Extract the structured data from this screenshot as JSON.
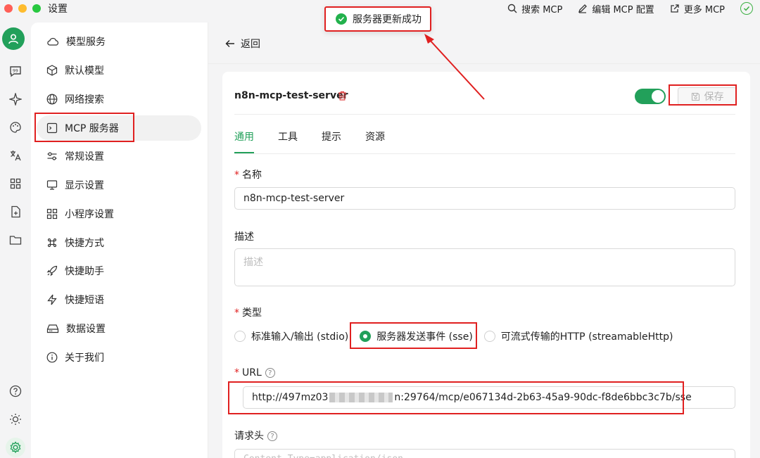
{
  "window": {
    "title": "设置"
  },
  "title_actions": [
    {
      "label": "搜索 MCP",
      "icon": "search-icon"
    },
    {
      "label": "编辑 MCP 配置",
      "icon": "edit-icon"
    },
    {
      "label": "更多 MCP",
      "icon": "external-link-icon"
    }
  ],
  "toast": {
    "text": "服务器更新成功"
  },
  "nav": {
    "items": [
      {
        "label": "模型服务",
        "icon": "cloud-icon"
      },
      {
        "label": "默认模型",
        "icon": "cube-icon"
      },
      {
        "label": "网络搜索",
        "icon": "globe-icon"
      },
      {
        "label": "MCP 服务器",
        "icon": "terminal-icon"
      },
      {
        "label": "常规设置",
        "icon": "sliders-icon"
      },
      {
        "label": "显示设置",
        "icon": "monitor-icon"
      },
      {
        "label": "小程序设置",
        "icon": "grid-icon"
      },
      {
        "label": "快捷方式",
        "icon": "command-icon"
      },
      {
        "label": "快捷助手",
        "icon": "rocket-icon"
      },
      {
        "label": "快捷短语",
        "icon": "zap-icon"
      },
      {
        "label": "数据设置",
        "icon": "hard-drive-icon"
      },
      {
        "label": "关于我们",
        "icon": "info-icon"
      }
    ],
    "active_index": 3
  },
  "main": {
    "back_label": "返回",
    "server_name": "n8n-mcp-test-server",
    "enabled": true,
    "save_label": "保存",
    "tabs": [
      "通用",
      "工具",
      "提示",
      "资源"
    ],
    "active_tab": 0,
    "form": {
      "name_label": "名称",
      "name_value": "n8n-mcp-test-server",
      "desc_label": "描述",
      "desc_placeholder": "描述",
      "type_label": "类型",
      "type_options": [
        "标准输入/输出 (stdio)",
        "服务器发送事件 (sse)",
        "可流式传输的HTTP (streamableHttp)"
      ],
      "type_selected": 1,
      "url_label": "URL",
      "url_prefix": "http://497mz03",
      "url_suffix": "n:29764/mcp/e067134d-2b63-45a9-90dc-f8de6bbc3c7b/sse",
      "headers_label": "请求头",
      "headers_placeholder": "Content-Type=application/json"
    }
  },
  "colors": {
    "accent": "#22a05a",
    "highlight": "#e02020",
    "toast_icon": "#22b14c"
  }
}
